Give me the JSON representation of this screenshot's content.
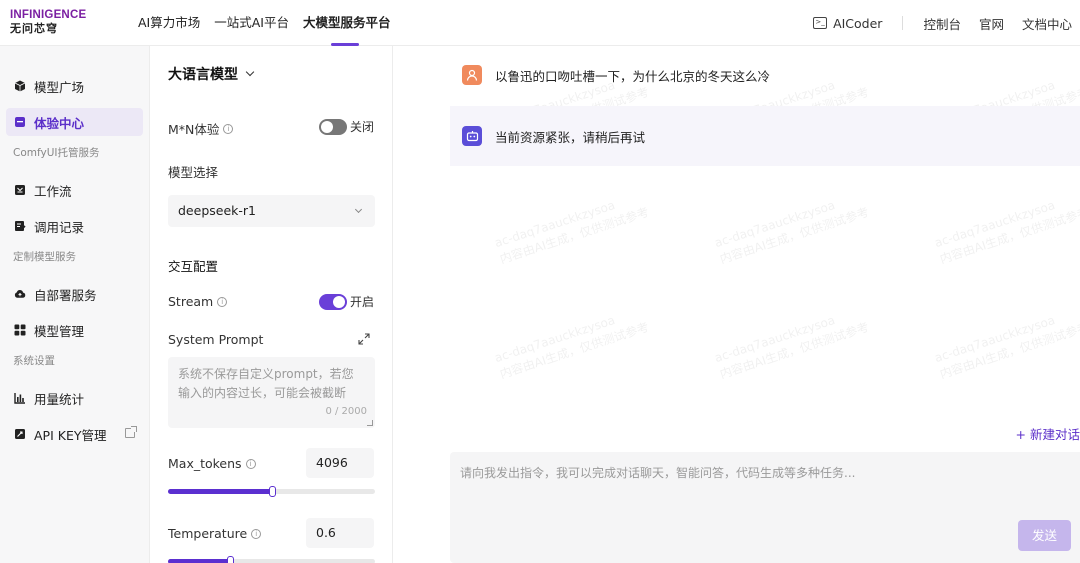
{
  "header": {
    "logo_top": "INFINIGENCE",
    "logo_bottom": "无问芯穹",
    "nav": [
      "AI算力市场",
      "一站式AI平台",
      "大模型服务平台"
    ],
    "aicoder": "AICoder",
    "right_links": [
      "控制台",
      "官网",
      "文档中心"
    ]
  },
  "sidebar": {
    "items": [
      {
        "label": "模型广场",
        "icon": "cube-icon"
      },
      {
        "label": "体验中心",
        "icon": "experience-icon"
      },
      {
        "label": "ComfyUI托管服务",
        "group": true
      },
      {
        "label": "工作流",
        "icon": "workflow-icon"
      },
      {
        "label": "调用记录",
        "icon": "record-icon"
      },
      {
        "label": "定制模型服务",
        "group": true
      },
      {
        "label": "自部署服务",
        "icon": "cloud-icon"
      },
      {
        "label": "模型管理",
        "icon": "grid-icon"
      },
      {
        "label": "系统设置",
        "group": true
      },
      {
        "label": "用量统计",
        "icon": "chart-icon"
      },
      {
        "label": "API KEY管理",
        "icon": "key-icon"
      }
    ]
  },
  "config": {
    "model_type": "大语言模型",
    "mn_label": "M*N体验",
    "mn_state": "关闭",
    "model_select_label": "模型选择",
    "model_value": "deepseek-r1",
    "interaction_label": "交互配置",
    "stream_label": "Stream",
    "stream_state": "开启",
    "system_prompt_label": "System Prompt",
    "system_prompt_placeholder": "系统不保存自定义prompt，若您输入的内容过长，可能会被截断",
    "system_prompt_counter": "0 / 2000",
    "max_tokens_label": "Max_tokens",
    "max_tokens_value": "4096",
    "max_tokens_fraction": 0.5,
    "temperature_label": "Temperature",
    "temperature_value": "0.6",
    "temperature_fraction": 0.3
  },
  "chat": {
    "user_message": "以鲁迅的口吻吐槽一下，为什么北京的冬天这么冷",
    "bot_message": "当前资源紧张，请稍后再试",
    "watermark_line1": "ac-daq7aauckkzysoa",
    "watermark_line2": "内容由AI生成，仅供测试参考",
    "new_chat": "+ 新建对话",
    "input_placeholder": "请向我发出指令，我可以完成对话聊天，智能问答，代码生成等多种任务...",
    "send": "发送"
  },
  "colors": {
    "accent": "#6a3fd8",
    "send_disabled": "#c5b6ec",
    "user_avatar": "#f08a5d",
    "bot_avatar": "#5b4ed8"
  }
}
